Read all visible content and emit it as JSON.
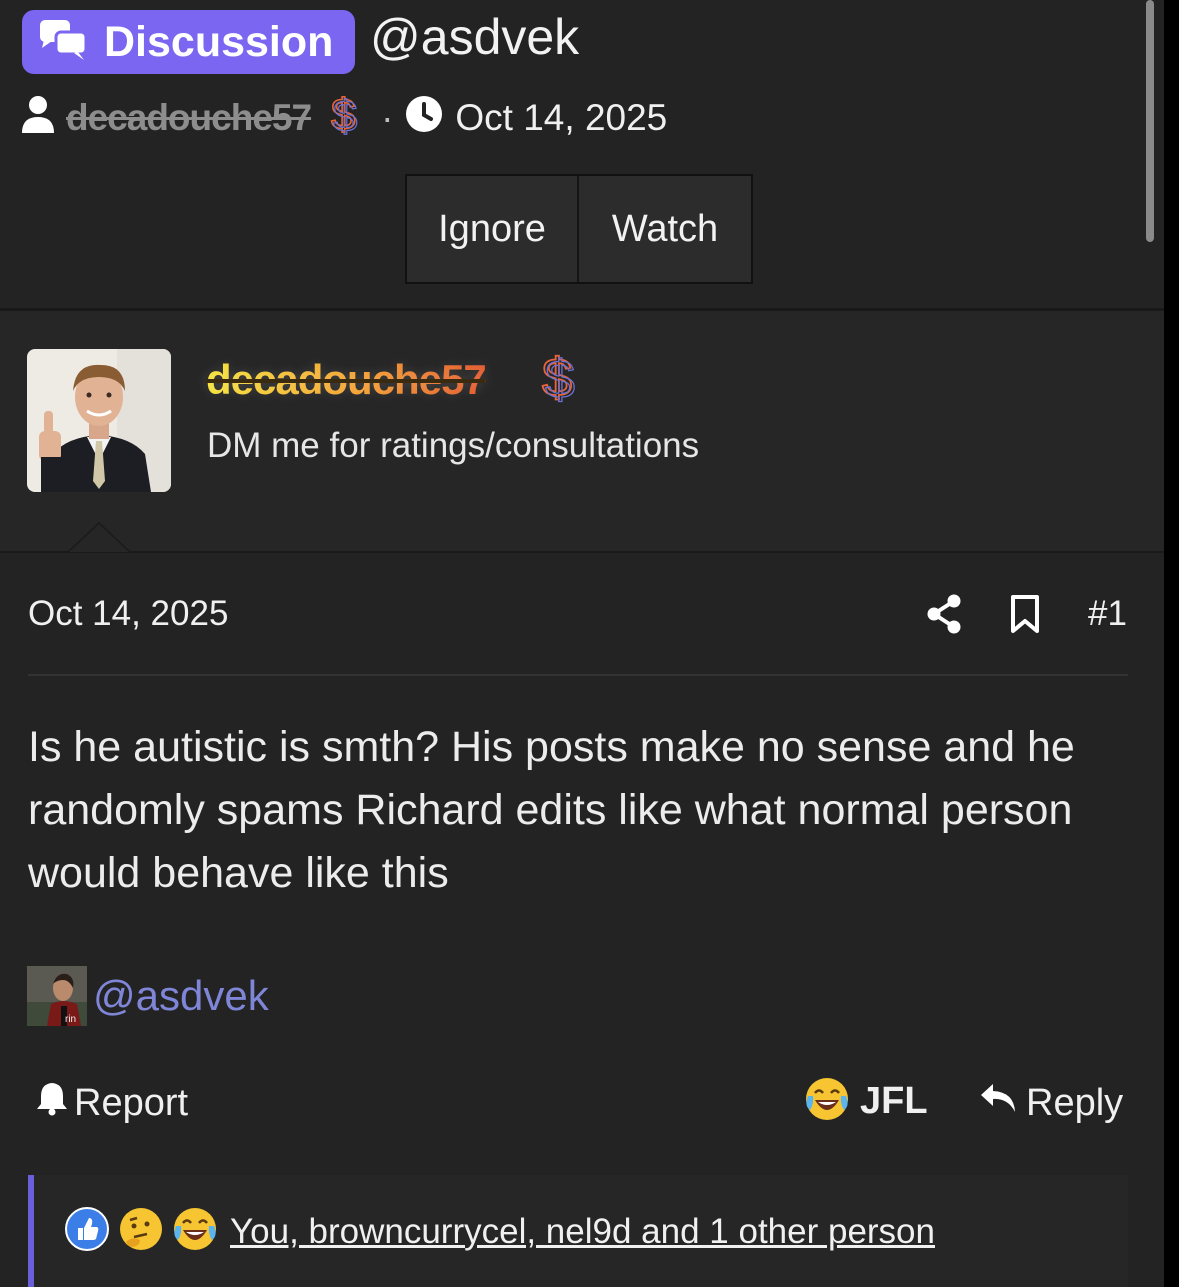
{
  "thread": {
    "prefix_label": "Discussion",
    "title": "@asdvek",
    "starter": "decadouche57",
    "date": "Oct 14, 2025"
  },
  "actions": {
    "ignore": "Ignore",
    "watch": "Watch"
  },
  "author": {
    "name": "decadouche57",
    "user_title": "DM me for ratings/consultations"
  },
  "post": {
    "date": "Oct 14, 2025",
    "number": "#1",
    "body": "Is he autistic is smth? His posts make no sense and he randomly spams Richard edits like what normal person would behave like this",
    "mention": "@asdvek",
    "report_label": "Report",
    "jfl_label": "JFL",
    "reply_label": "Reply",
    "reactions_text": "You, browncurrycel, nel9d and 1 other person"
  },
  "colors": {
    "background": "#232323",
    "badge": "#7b66f2",
    "mention": "#7f86d8",
    "reaction_bar_accent": "#6a5fd8"
  },
  "icons": [
    "chat-bubbles-icon",
    "user-icon",
    "dollar-icon",
    "clock-icon",
    "share-icon",
    "bookmark-icon",
    "bell-icon",
    "laughing-crying-emoji",
    "reply-arrow-icon",
    "like-emoji",
    "thinking-emoji"
  ]
}
